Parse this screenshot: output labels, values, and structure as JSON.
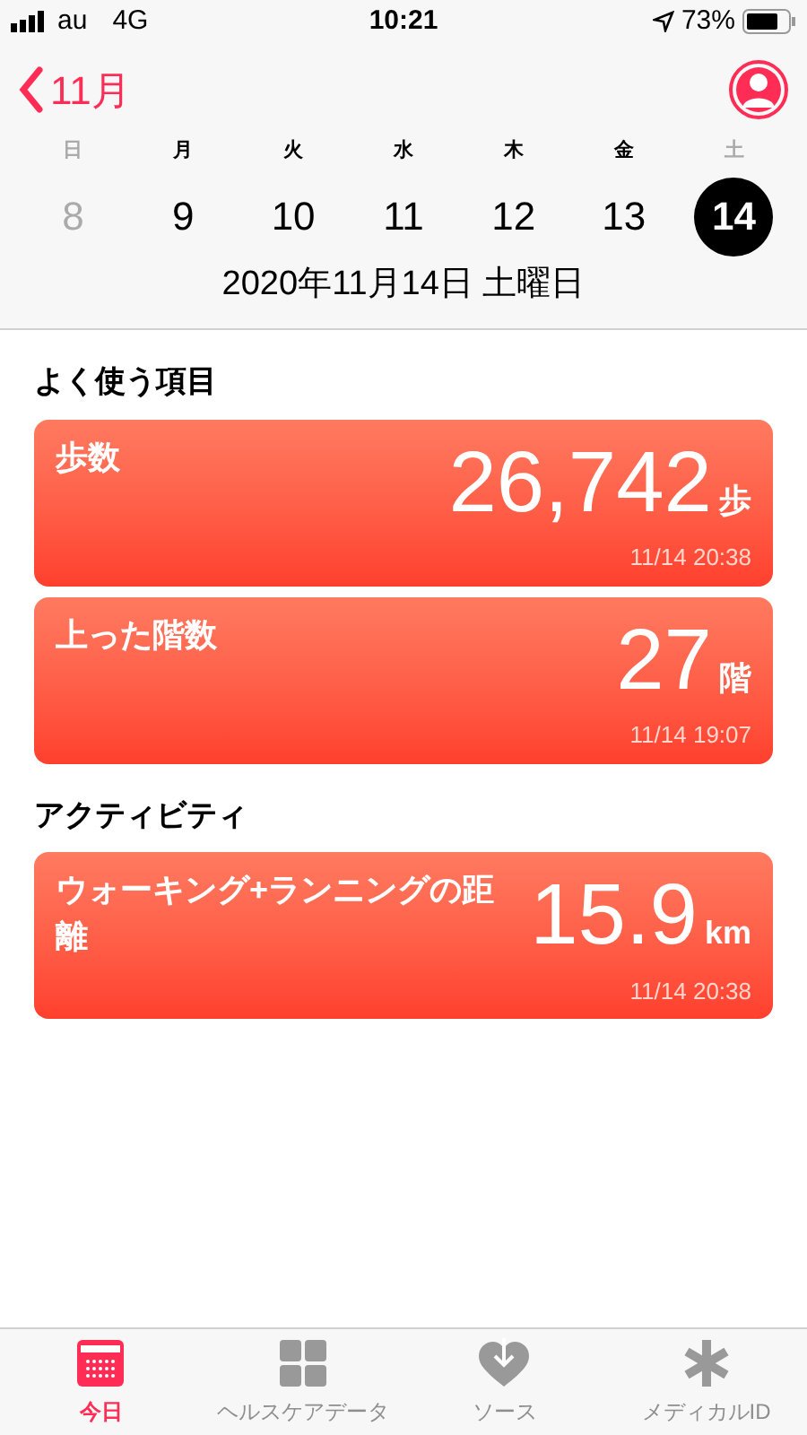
{
  "status_bar": {
    "carrier": "au",
    "network": "4G",
    "time": "10:21",
    "battery": "73%"
  },
  "nav": {
    "back_label": "11月"
  },
  "week": [
    {
      "weekday": "日",
      "date": "8",
      "dimmed": true,
      "selected": false
    },
    {
      "weekday": "月",
      "date": "9",
      "dimmed": false,
      "selected": false
    },
    {
      "weekday": "火",
      "date": "10",
      "dimmed": false,
      "selected": false
    },
    {
      "weekday": "水",
      "date": "11",
      "dimmed": false,
      "selected": false
    },
    {
      "weekday": "木",
      "date": "12",
      "dimmed": false,
      "selected": false
    },
    {
      "weekday": "金",
      "date": "13",
      "dimmed": false,
      "selected": false
    },
    {
      "weekday": "土",
      "date": "14",
      "dimmed": true,
      "selected": true
    }
  ],
  "selected_date": "2020年11月14日 土曜日",
  "sections": [
    {
      "title": "よく使う項目",
      "cards": [
        {
          "title": "歩数",
          "value": "26,742",
          "unit": "歩",
          "time": "11/14 20:38"
        },
        {
          "title": "上った階数",
          "value": "27",
          "unit": "階",
          "time": "11/14 19:07"
        }
      ]
    },
    {
      "title": "アクティビティ",
      "cards": [
        {
          "title": "ウォーキング+ランニングの距離",
          "value": "15.9",
          "unit": "km",
          "time": "11/14 20:38"
        }
      ]
    }
  ],
  "tab_bar": [
    {
      "label": "今日",
      "kind": "calendar",
      "selected": true
    },
    {
      "label": "ヘルスケアデータ",
      "kind": "grid",
      "selected": false
    },
    {
      "label": "ソース",
      "kind": "heart",
      "selected": false
    },
    {
      "label": "メディカルID",
      "kind": "asterisk",
      "selected": false
    }
  ]
}
